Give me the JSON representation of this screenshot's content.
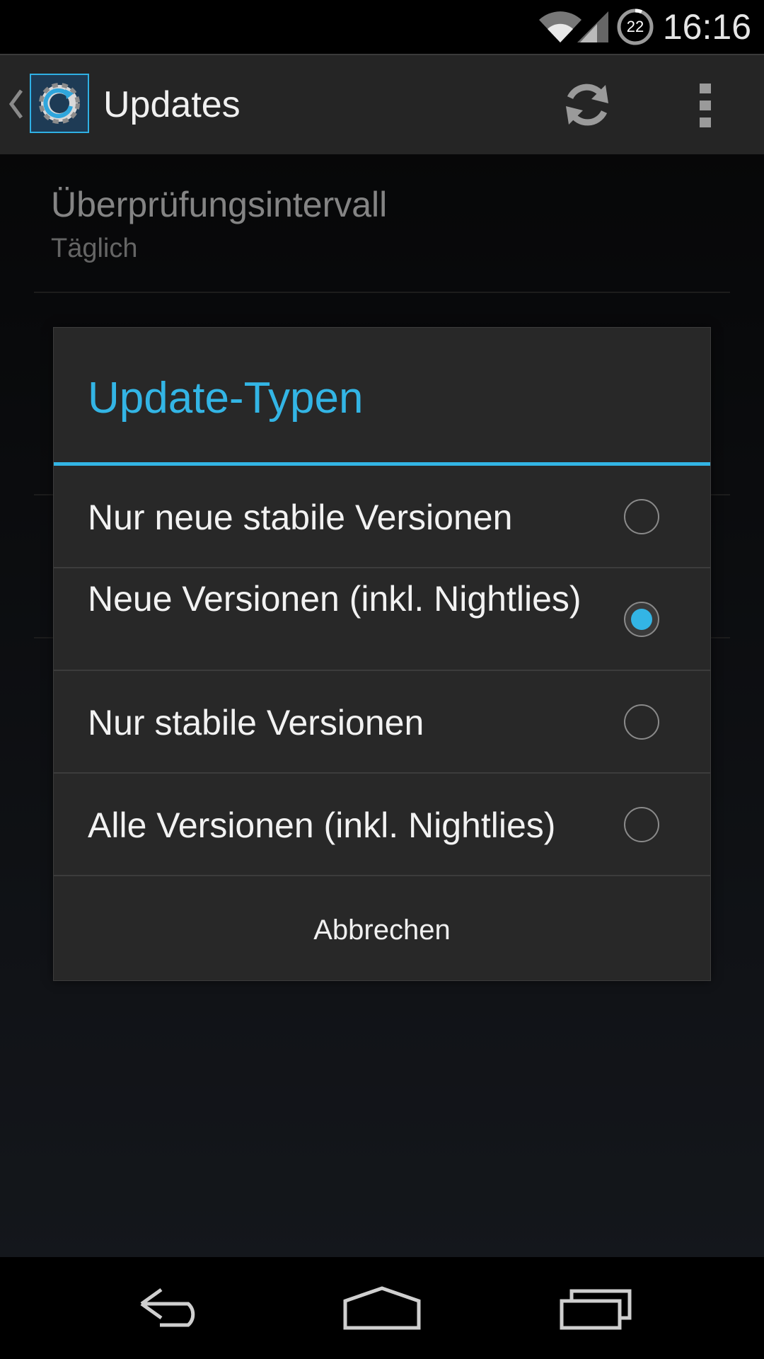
{
  "status_bar": {
    "time": "16:16",
    "battery_level": "22",
    "icons": [
      "wifi-icon",
      "signal-icon",
      "battery-icon"
    ]
  },
  "action_bar": {
    "title": "Updates",
    "icons": [
      "up-caret-icon",
      "app-settings-update-icon",
      "refresh-icon",
      "overflow-menu-icon"
    ]
  },
  "preferences": [
    {
      "title": "Überprüfungsintervall",
      "summary": "Täglich"
    }
  ],
  "dialog": {
    "title": "Update-Typen",
    "options": [
      {
        "label": "Nur neue stabile Versionen",
        "selected": false
      },
      {
        "label": "Neue Versionen (inkl. Nightlies)",
        "selected": true
      },
      {
        "label": "Nur stabile Versionen",
        "selected": false
      },
      {
        "label": "Alle Versionen (inkl. Nightlies)",
        "selected": false
      }
    ],
    "cancel_label": "Abbrechen"
  },
  "nav_bar": {
    "icons": [
      "back-icon",
      "home-icon",
      "recents-icon"
    ]
  },
  "colors": {
    "accent": "#33b5e5",
    "action_bar_bg": "#252525",
    "dialog_bg": "#282828"
  }
}
